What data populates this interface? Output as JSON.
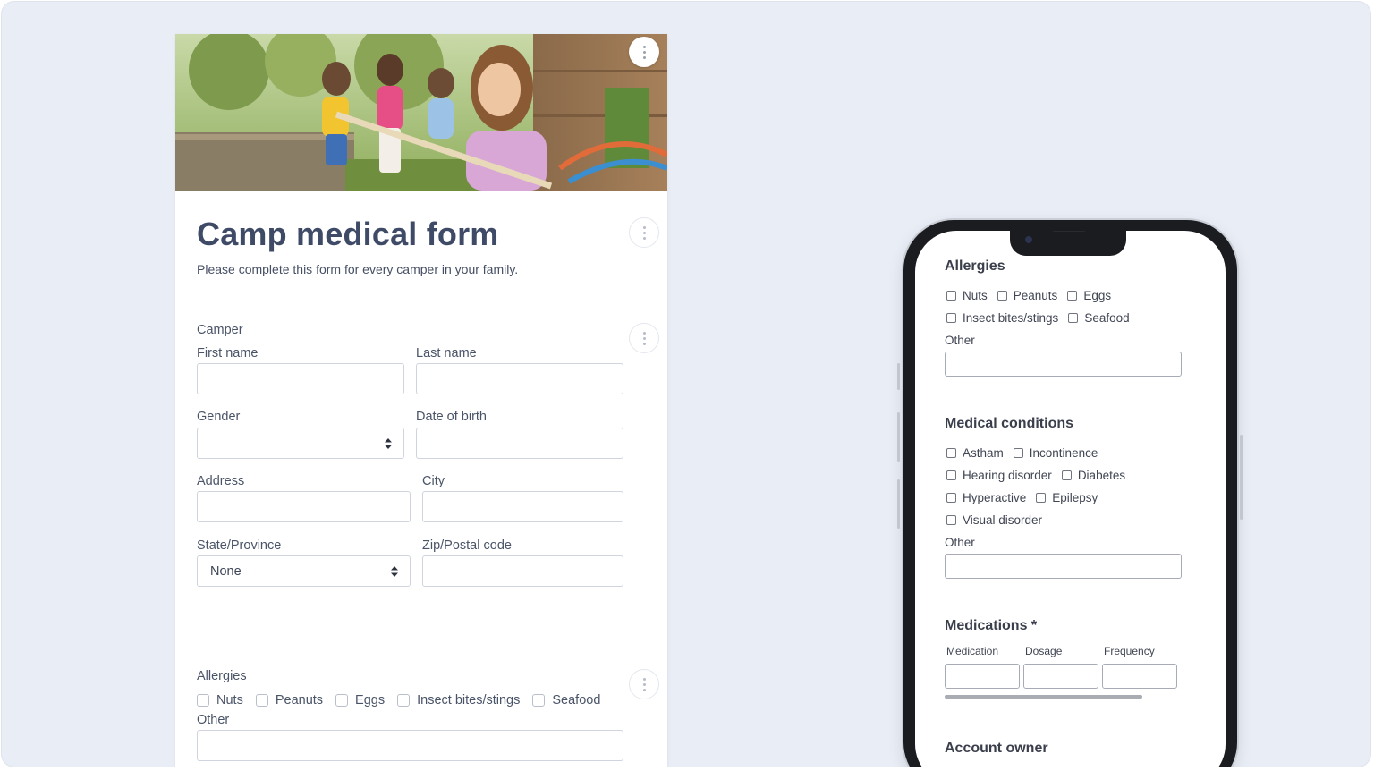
{
  "form": {
    "title": "Camp medical form",
    "subtitle": "Please complete this form for every camper in your family.",
    "camper_section": "Camper",
    "fields": {
      "first_name": "First name",
      "last_name": "Last name",
      "gender": "Gender",
      "date_of_birth": "Date of birth",
      "address": "Address",
      "city": "City",
      "state": "State/Province",
      "state_value": "None",
      "zip": "Zip/Postal code"
    },
    "allergies": {
      "label": "Allergies",
      "options": [
        "Nuts",
        "Peanuts",
        "Eggs",
        "Insect bites/stings",
        "Seafood"
      ],
      "other_label": "Other"
    }
  },
  "mobile": {
    "allergies": {
      "heading": "Allergies",
      "row1": [
        "Nuts",
        "Peanuts",
        "Eggs"
      ],
      "row2": [
        "Insect bites/stings",
        "Seafood"
      ],
      "other_label": "Other"
    },
    "medical_conditions": {
      "heading": "Medical conditions",
      "row1": [
        "Astham",
        "Incontinence"
      ],
      "row2": [
        "Hearing disorder",
        "Diabetes"
      ],
      "row3": [
        "Hyperactive",
        "Epilepsy"
      ],
      "row4": [
        "Visual disorder"
      ],
      "other_label": "Other"
    },
    "medications": {
      "heading": "Medications *",
      "columns": [
        "Medication",
        "Dosage",
        "Frequency"
      ]
    },
    "account_owner": {
      "heading": "Account owner"
    }
  },
  "colors": {
    "background": "#e9edf5",
    "title": "#3f4b66",
    "input_border": "#cfd4de",
    "phone_frame": "#1b1c20"
  },
  "icons": [
    "kebab-menu-icon",
    "select-arrows-icon",
    "checkbox-icon",
    "camera-icon"
  ]
}
